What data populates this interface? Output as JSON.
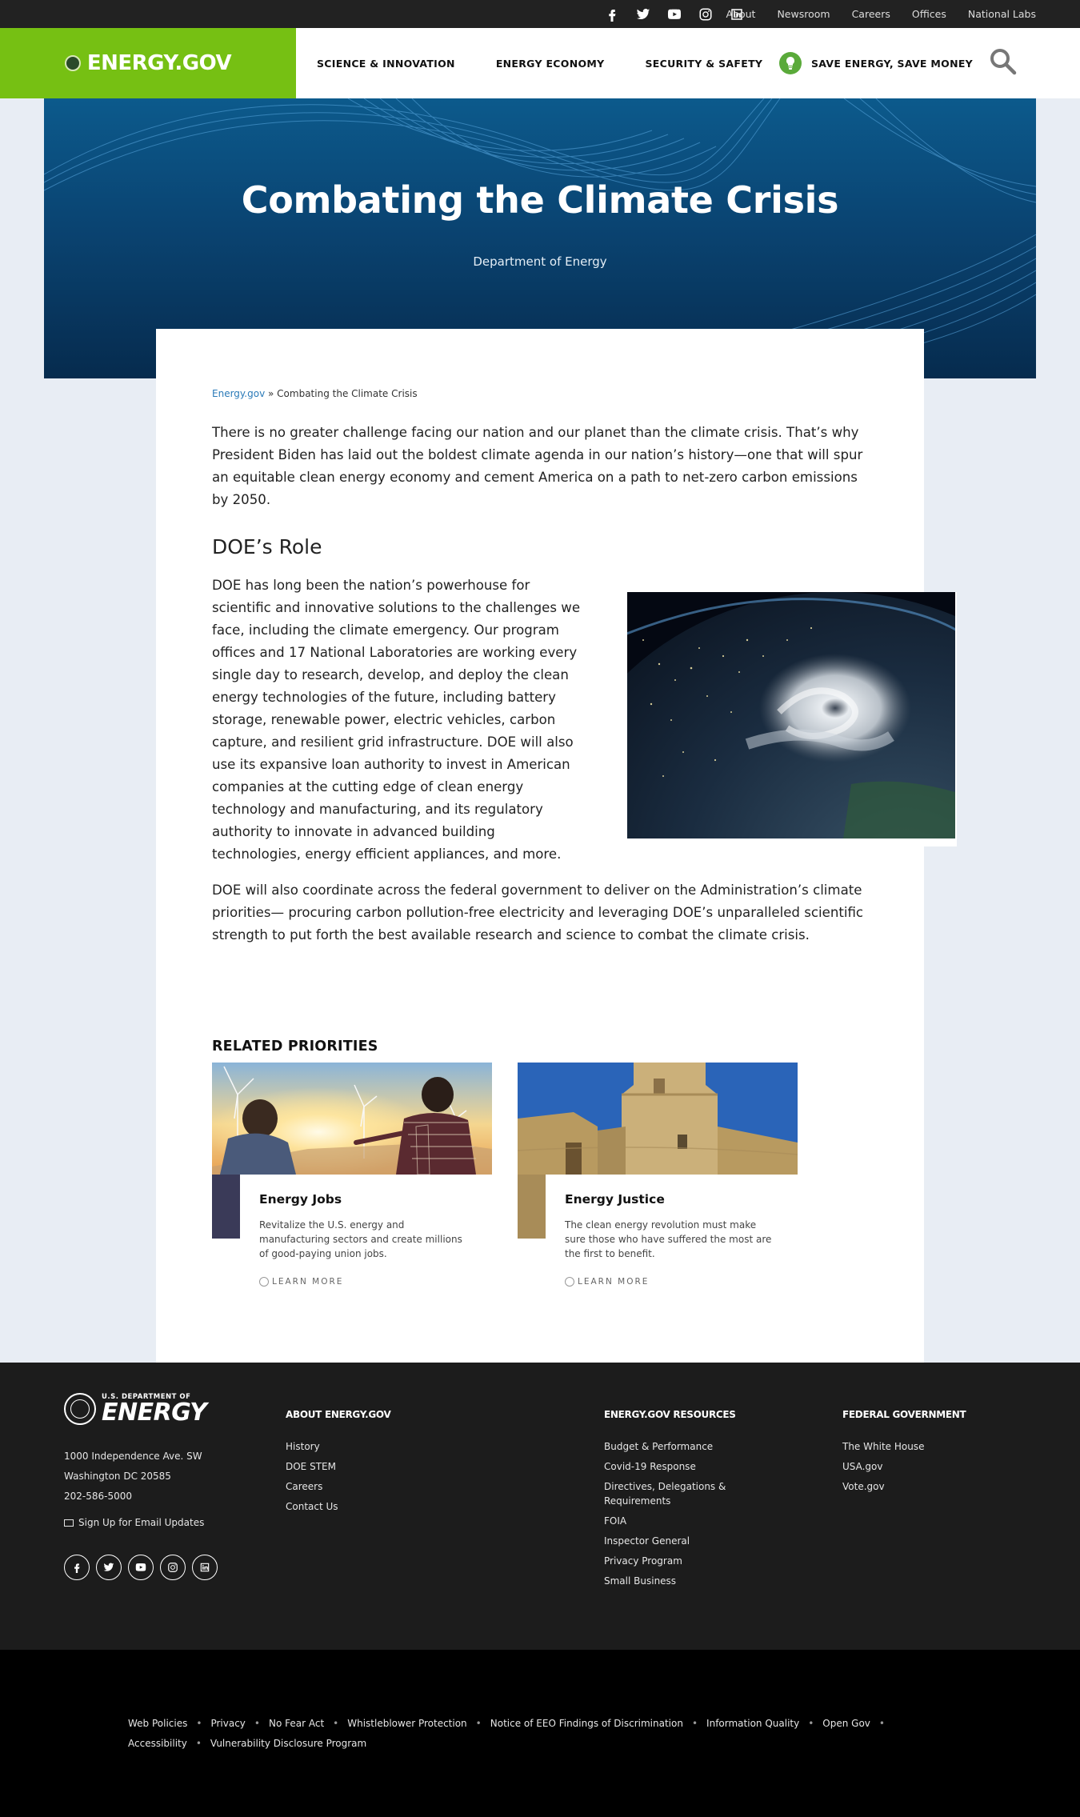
{
  "utility": {
    "social": [
      "facebook-icon",
      "twitter-icon",
      "youtube-icon",
      "instagram-icon",
      "linkedin-icon"
    ],
    "links": [
      "About",
      "Newsroom",
      "Careers",
      "Offices",
      "National Labs"
    ]
  },
  "header": {
    "logo_text": "ENERGY.GOV",
    "nav": [
      "SCIENCE & INNOVATION",
      "ENERGY ECONOMY",
      "SECURITY & SAFETY"
    ],
    "save_energy": "SAVE ENERGY, SAVE MONEY",
    "colors": {
      "brand_green": "#76c013",
      "save_green": "#5aaa3a"
    }
  },
  "hero": {
    "title": "Combating the Climate Crisis",
    "subtitle": "Department of Energy"
  },
  "breadcrumb": {
    "home": "Energy.gov",
    "separator": " » ",
    "current": "Combating the Climate Crisis"
  },
  "content": {
    "intro": "There is no greater challenge facing our nation and our planet than the climate crisis. That’s why President Biden has laid out the boldest climate agenda in our nation’s history—one that will spur an equitable clean energy economy and cement America on a path to net-zero carbon emissions by 2050.",
    "role_heading": "DOE’s Role",
    "role_text": "DOE has long been the nation’s powerhouse for scientific and innovative solutions to the challenges we face, including the climate emergency. Our program offices and 17 National Laboratories are working every single day to research, develop, and deploy the clean energy technologies of the future, including battery storage, renewable power, electric vehicles, carbon capture, and resilient grid infrastructure. DOE will also use its expansive loan authority to invest in American companies at the cutting edge of clean energy technology and manufacturing, and its regulatory authority to innovate in advanced building technologies, energy efficient appliances, and more.",
    "closing": "DOE will also coordinate across the federal government to deliver on the Administration’s climate priorities— procuring carbon pollution-free electricity and leveraging DOE’s unparalleled scientific strength to put forth the best available research and science to combat the climate crisis."
  },
  "related": {
    "title": "RELATED PRIORITIES",
    "items": [
      {
        "title": "Energy Jobs",
        "desc": "Revitalize the U.S. energy and manufacturing sectors and create millions of good-paying union jobs.",
        "cta": "LEARN MORE"
      },
      {
        "title": "Energy Justice",
        "desc": "The clean energy revolution must make sure those who have suffered the most are the first to benefit.",
        "cta": "LEARN MORE"
      }
    ]
  },
  "footer": {
    "logo_small": "U.S. DEPARTMENT OF",
    "logo_big": "ENERGY",
    "address": [
      "1000 Independence Ave. SW",
      "Washington DC 20585",
      "202-586-5000"
    ],
    "signup": "Sign Up for Email Updates",
    "about_heading": "ABOUT ENERGY.GOV",
    "about_links": [
      "History",
      "DOE STEM",
      "Careers",
      "Contact Us"
    ],
    "resources_heading": "ENERGY.GOV RESOURCES",
    "resources_links": [
      "Budget & Performance",
      "Covid-19 Response",
      "Directives, Delegations & Requirements",
      "FOIA",
      "Inspector General",
      "Privacy Program",
      "Small Business"
    ],
    "federal_heading": "FEDERAL GOVERNMENT",
    "federal_links": [
      "The White House",
      "USA.gov",
      "Vote.gov"
    ]
  },
  "legal": {
    "links": [
      "Web Policies",
      "Privacy",
      "No Fear Act",
      "Whistleblower Protection",
      "Notice of EEO Findings of Discrimination",
      "Information Quality",
      "Open Gov",
      "Accessibility",
      "Vulnerability Disclosure Program"
    ]
  }
}
